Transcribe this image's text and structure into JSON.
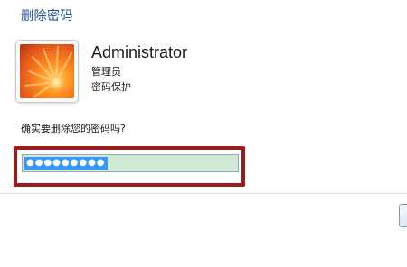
{
  "dialog": {
    "title": "删除密码"
  },
  "user": {
    "avatar_icon": "flower-avatar-icon",
    "name": "Administrator",
    "role": "管理员",
    "status": "密码保护"
  },
  "prompt": {
    "question": "确实要删除您的密码吗?"
  },
  "password_field": {
    "masked_value": "●●●●●●●●●"
  },
  "colors": {
    "title": "#1e4f8f",
    "highlight_border": "#9b1c1f",
    "field_background": "#cfe9d2",
    "selection": "#3399ff"
  }
}
